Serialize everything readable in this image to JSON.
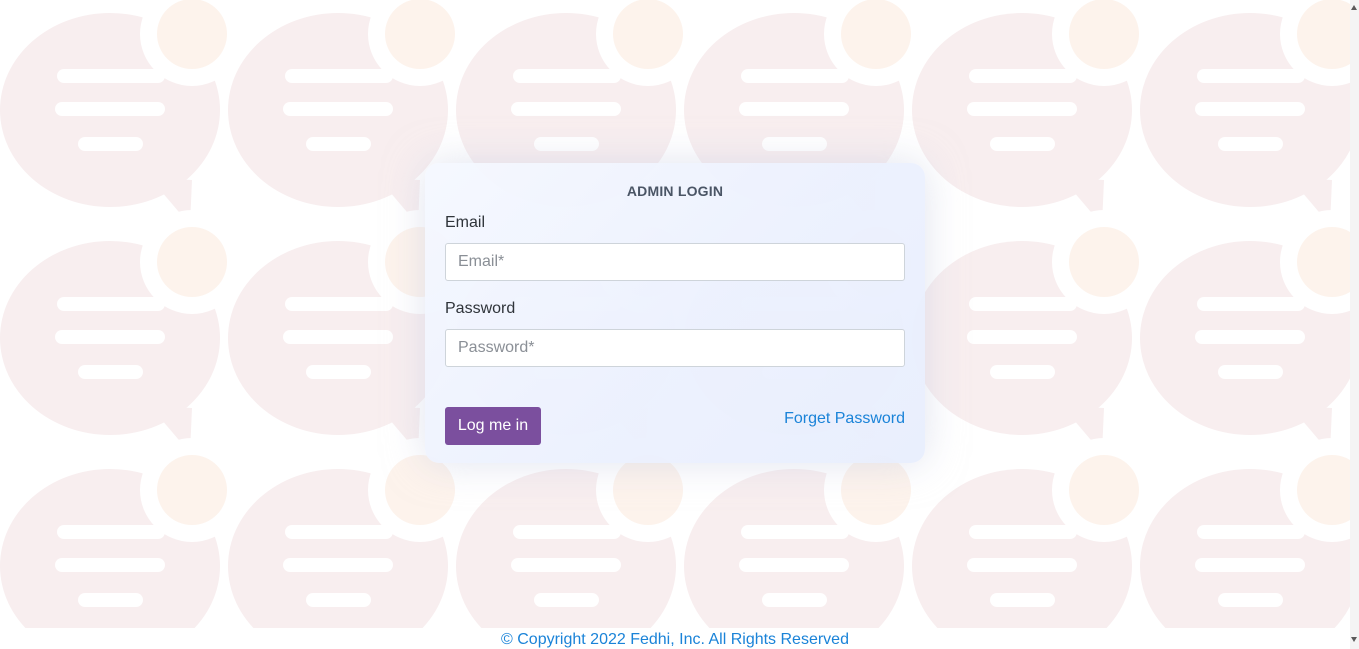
{
  "login": {
    "title": "ADMIN LOGIN",
    "email_label": "Email",
    "email_placeholder": "Email*",
    "email_value": "",
    "password_label": "Password",
    "password_placeholder": "Password*",
    "password_value": "",
    "submit_label": "Log me in",
    "forgot_label": "Forget Password"
  },
  "footer": {
    "copyright": "© Copyright 2022 Fedhi, Inc. All Rights Reserved"
  },
  "background": {
    "pattern": "chat-bubble-icon",
    "bubble_color": "#f8eeef",
    "dot_color": "#fdf3ec"
  },
  "colors": {
    "primary": "#7b4f9e",
    "link": "#1a83d8",
    "title": "#4a5565"
  }
}
